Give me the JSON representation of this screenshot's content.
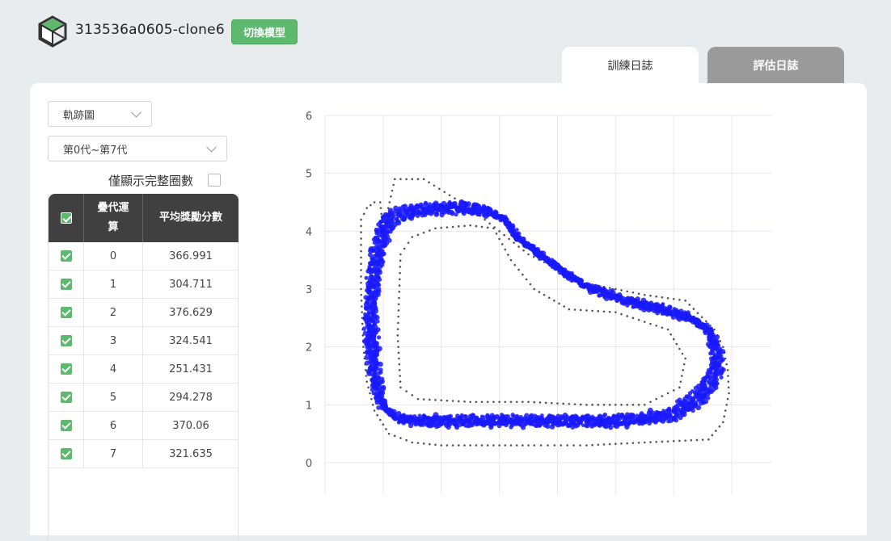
{
  "header": {
    "model_name": "313536a0605-clone6",
    "switch_button_label": "切換模型",
    "logo_icon": "cube-logo-icon"
  },
  "tabs": [
    {
      "label": "訓練日誌",
      "active": true
    },
    {
      "label": "評估日誌",
      "active": false
    }
  ],
  "controls": {
    "view_select": "軌跡圖",
    "generation_select": "第0代~第7代",
    "full_lap_label": "僅顯示完整圈數",
    "full_lap_checked": false
  },
  "table": {
    "columns": [
      "疊代運",
      "算",
      "平均獎勵分數"
    ],
    "header_check": true,
    "rows": [
      {
        "iteration": "0",
        "score": "366.991",
        "checked": true
      },
      {
        "iteration": "1",
        "score": "304.711",
        "checked": true
      },
      {
        "iteration": "2",
        "score": "376.629",
        "checked": true
      },
      {
        "iteration": "3",
        "score": "324.541",
        "checked": true
      },
      {
        "iteration": "4",
        "score": "251.431",
        "checked": true
      },
      {
        "iteration": "5",
        "score": "294.278",
        "checked": true
      },
      {
        "iteration": "6",
        "score": "370.06",
        "checked": true
      },
      {
        "iteration": "7",
        "score": "321.635",
        "checked": true
      }
    ]
  },
  "colors": {
    "accent_green": "#5cb96e",
    "trajectory_blue": "#1a1aff",
    "track_border": "#555555",
    "header_dark": "#404040"
  },
  "chart_data": {
    "type": "scatter",
    "title": "",
    "xlabel": "",
    "ylabel": "",
    "ylim": [
      0,
      6
    ],
    "yticks": [
      "0",
      "1",
      "2",
      "3",
      "4",
      "5",
      "6"
    ],
    "xlim": [
      0,
      8
    ],
    "grid": true,
    "series": [
      {
        "role": "track-outer-border",
        "color": "#555555",
        "x": [
          1.0,
          0.95,
          0.85,
          0.72,
          0.62,
          0.62,
          0.66,
          0.72,
          0.85,
          1.1,
          1.5,
          2.0,
          2.8,
          3.4,
          3.6,
          3.95,
          4.5,
          5.5,
          6.6,
          6.85,
          6.95,
          6.93,
          6.85,
          6.7,
          6.2,
          5.5,
          4.5,
          3.5,
          2.5,
          1.7,
          1.2,
          1.0
        ],
        "y": [
          4.0,
          4.5,
          4.5,
          4.4,
          4.2,
          3.0,
          2.0,
          1.4,
          0.9,
          0.5,
          0.35,
          0.3,
          0.3,
          0.3,
          0.3,
          0.3,
          0.3,
          0.35,
          0.4,
          0.7,
          1.2,
          1.6,
          2.0,
          2.3,
          2.8,
          2.9,
          3.1,
          3.6,
          4.4,
          4.9,
          4.9,
          4.0
        ]
      },
      {
        "role": "track-inner-border",
        "color": "#555555",
        "x": [
          1.3,
          1.5,
          1.9,
          2.5,
          2.9,
          3.2,
          3.6,
          4.2,
          5.0,
          5.9,
          6.2,
          6.1,
          5.5,
          4.5,
          3.5,
          2.5,
          1.6,
          1.3,
          1.25,
          1.3
        ],
        "y": [
          3.6,
          3.9,
          4.05,
          4.1,
          4.05,
          3.5,
          3.0,
          2.65,
          2.6,
          2.3,
          1.8,
          1.3,
          1.0,
          1.0,
          1.05,
          1.05,
          1.1,
          1.3,
          2.2,
          3.6
        ]
      },
      {
        "role": "trajectories",
        "color": "#1a1aff",
        "x": [
          1.05,
          0.95,
          0.85,
          0.8,
          0.8,
          0.82,
          0.88,
          0.95,
          1.05,
          1.3,
          1.6,
          2.0,
          2.5,
          3.0,
          3.5,
          4.0,
          4.5,
          5.0,
          5.5,
          6.0,
          6.4,
          6.65,
          6.75,
          6.72,
          6.6,
          6.3,
          5.8,
          5.2,
          4.6,
          4.1,
          3.7,
          3.3,
          3.1,
          2.8,
          2.4,
          2.0,
          1.6,
          1.3,
          1.1,
          1.05
        ],
        "y": [
          4.1,
          3.8,
          3.3,
          2.8,
          2.3,
          1.8,
          1.4,
          1.1,
          0.9,
          0.75,
          0.72,
          0.72,
          0.72,
          0.72,
          0.72,
          0.72,
          0.72,
          0.72,
          0.75,
          0.85,
          1.1,
          1.4,
          1.7,
          2.0,
          2.3,
          2.5,
          2.65,
          2.8,
          3.0,
          3.3,
          3.6,
          3.9,
          4.2,
          4.35,
          4.4,
          4.4,
          4.35,
          4.3,
          4.2,
          4.1
        ]
      }
    ]
  }
}
